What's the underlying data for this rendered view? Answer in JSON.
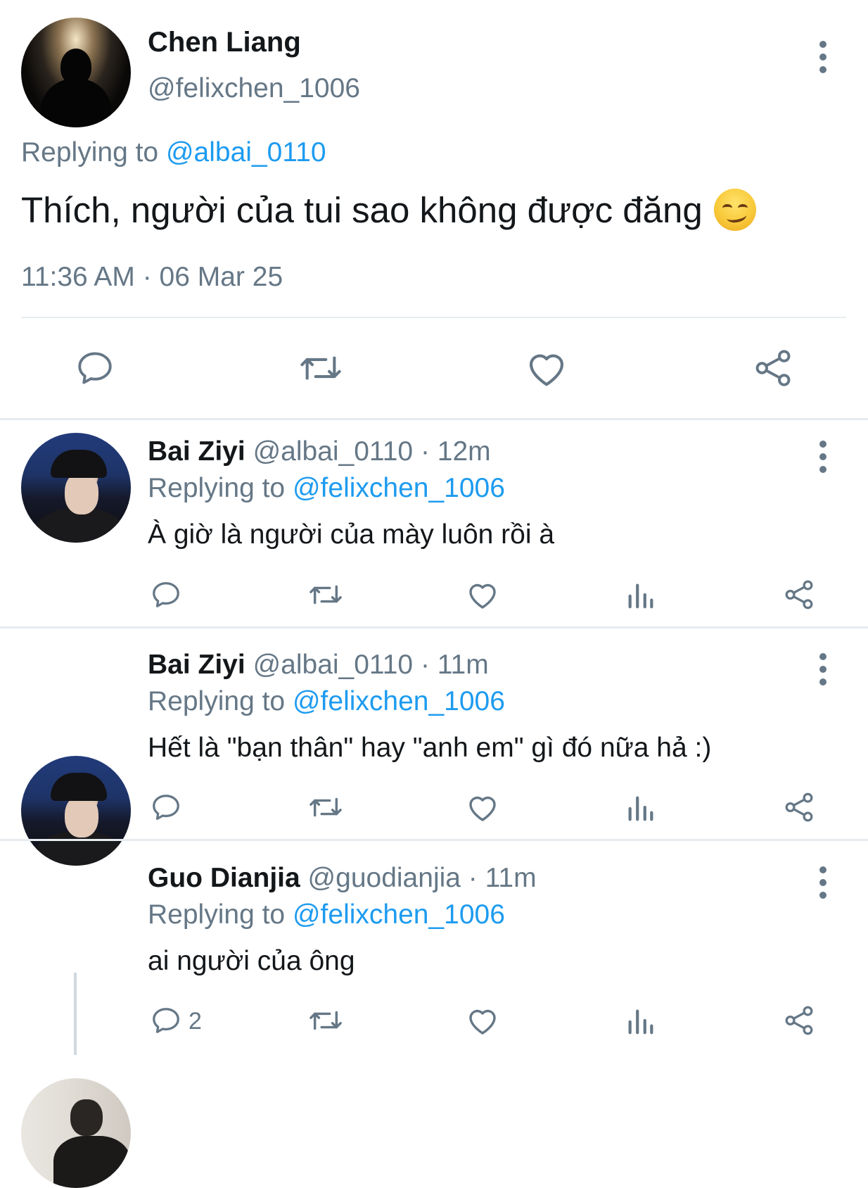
{
  "main_tweet": {
    "name": "Chen Liang",
    "handle": "@felixchen_1006",
    "replying_prefix": "Replying to",
    "replying_to": "@albai_0110",
    "text": "Thích, người của tui sao không được đăng",
    "emoji": "smirking-face",
    "timestamp": "11:36 AM · 06 Mar 25"
  },
  "replies": [
    {
      "name": "Bai Ziyi",
      "handle_time": "@albai_0110 · 12m",
      "replying_prefix": "Replying to",
      "replying_to": "@felixchen_1006",
      "text": "À giờ là người của mày luôn rồi à",
      "reply_count": ""
    },
    {
      "name": "Bai Ziyi",
      "handle_time": "@albai_0110 · 11m",
      "replying_prefix": "Replying to",
      "replying_to": "@felixchen_1006",
      "text": "Hết là \"bạn thân\" hay \"anh em\" gì đó nữa hả :)",
      "reply_count": ""
    },
    {
      "name": "Guo Dianjia",
      "handle_time": "@guodianjia · 11m",
      "replying_prefix": "Replying to",
      "replying_to": "@felixchen_1006",
      "text": "ai người của ông",
      "reply_count": "2"
    }
  ],
  "colors": {
    "accent": "#1d9bf0",
    "muted": "#657786",
    "divider": "#e6ecf0"
  }
}
